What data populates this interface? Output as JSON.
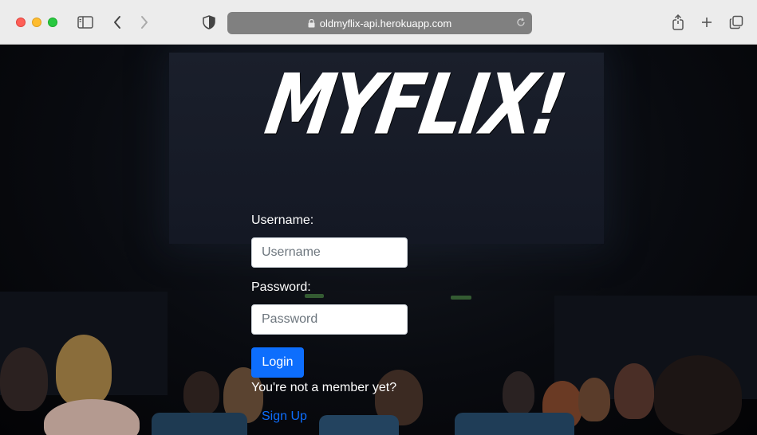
{
  "browser": {
    "url": "oldmyflix-api.herokuapp.com",
    "icons": [
      "close-window",
      "minimize-window",
      "zoom-window",
      "sidebar",
      "back-arrow",
      "forward-arrow",
      "privacy-shield",
      "lock",
      "reload",
      "share",
      "new-tab",
      "tab-overview"
    ]
  },
  "page": {
    "logo": "MYFLIX!",
    "form": {
      "username_label": "Username:",
      "username_placeholder": "Username",
      "username_value": "",
      "password_label": "Password:",
      "password_placeholder": "Password",
      "password_value": "",
      "login_label": "Login",
      "member_prompt": "You're not a member yet?",
      "signup_label": "Sign Up"
    }
  },
  "colors": {
    "accent": "#0d6efd",
    "background": "#090b10",
    "text": "#ffffff"
  }
}
